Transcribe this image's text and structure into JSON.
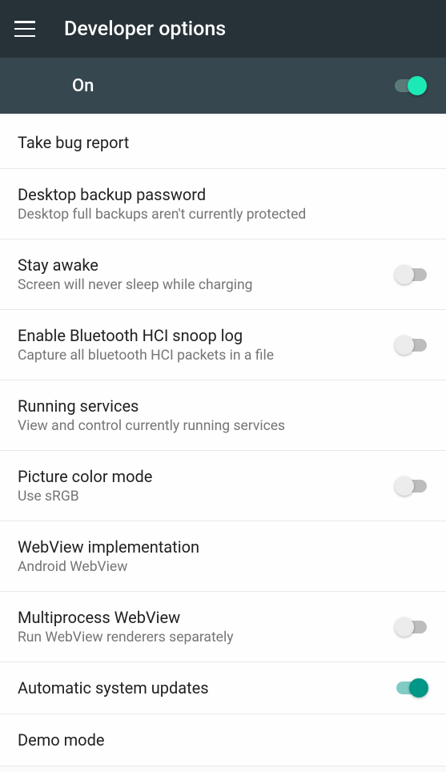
{
  "header": {
    "title": "Developer options"
  },
  "master": {
    "label": "On",
    "enabled": true
  },
  "items": [
    {
      "title": "Take bug report",
      "subtitle": null,
      "has_switch": false
    },
    {
      "title": "Desktop backup password",
      "subtitle": "Desktop full backups aren't currently protected",
      "has_switch": false
    },
    {
      "title": "Stay awake",
      "subtitle": "Screen will never sleep while charging",
      "has_switch": true,
      "switch_on": false
    },
    {
      "title": "Enable Bluetooth HCI snoop log",
      "subtitle": "Capture all bluetooth HCI packets in a file",
      "has_switch": true,
      "switch_on": false
    },
    {
      "title": "Running services",
      "subtitle": "View and control currently running services",
      "has_switch": false
    },
    {
      "title": "Picture color mode",
      "subtitle": "Use sRGB",
      "has_switch": true,
      "switch_on": false
    },
    {
      "title": "WebView implementation",
      "subtitle": "Android WebView",
      "has_switch": false
    },
    {
      "title": "Multiprocess WebView",
      "subtitle": "Run WebView renderers separately",
      "has_switch": true,
      "switch_on": false
    },
    {
      "title": "Automatic system updates",
      "subtitle": null,
      "has_switch": true,
      "switch_on": true
    },
    {
      "title": "Demo mode",
      "subtitle": null,
      "has_switch": false
    }
  ]
}
